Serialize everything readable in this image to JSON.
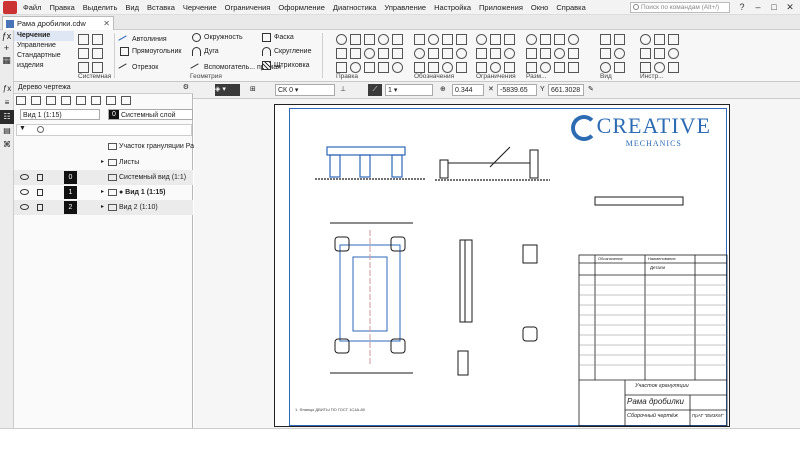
{
  "menu": {
    "items": [
      "Файл",
      "Правка",
      "Выделить",
      "Вид",
      "Вставка",
      "Черчение",
      "Ограничения",
      "Оформление",
      "Диагностика",
      "Управление",
      "Настройка",
      "Приложения",
      "Окно",
      "Справка"
    ],
    "search_placeholder": "Поиск по командам (Alt+/)"
  },
  "tab": {
    "title": "Рама дробилки.cdw"
  },
  "ribbon": {
    "modes": [
      "Черчение",
      "Управление",
      "Стандартные",
      "изделия"
    ],
    "system_group": "Системная",
    "geometry_buttons": [
      "Автолиния",
      "Прямоугольник",
      "Отрезок",
      "Окружность",
      "Дуга",
      "Вспомогатель... прямая",
      "Фаска",
      "Скругление",
      "Штриховка"
    ],
    "geometry_group": "Геометрия",
    "group_labels": [
      "Правка",
      "Обозначения",
      "Ограничения",
      "Разм...",
      "Вид",
      "Инстр..."
    ]
  },
  "propbar": {
    "cs": "СК 0",
    "layer_num": "1",
    "scale": "0.344",
    "x_coord": "-5839.65",
    "y_label": "Y",
    "y_coord": "661.3028"
  },
  "tree": {
    "header": "Дерево чертежа",
    "view_selector": "Вид 1 (1:15)",
    "layer_num": "0",
    "layer_selector": "Системный слой",
    "rows": [
      {
        "num": "",
        "label": "Участок грануляции Ра"
      },
      {
        "num": "",
        "label": "Листы"
      },
      {
        "num": "0",
        "label": "Системный вид (1:1)"
      },
      {
        "num": "1",
        "label": "● Вид 1 (1:15)"
      },
      {
        "num": "2",
        "label": "Вид 2 (1:10)"
      }
    ]
  },
  "drawing": {
    "brand_big": "CREATIVE",
    "brand_small": "MECHANICS",
    "stamp": "Участок грануляции",
    "name": "Рама дробилки",
    "doc_type": "Сборочный чертёж",
    "org": "ПрАТ \"ВМЗКМ\"",
    "footnote": "1. Фланцы ДВИТЫ ПО ГОСТ 1С4А-80",
    "spec_header_1": "Обозначение",
    "spec_header_2": "Наименование",
    "spec_section": "Детали"
  },
  "colors": {
    "accent": "#2d6cb3",
    "lines": "#1a1a1a"
  }
}
